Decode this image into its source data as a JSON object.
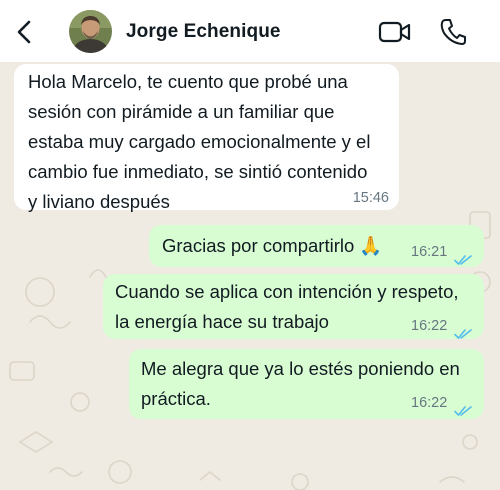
{
  "header": {
    "contact_name": "Jorge Echenique",
    "back_icon": "chevron-left-icon",
    "video_icon": "video-camera-icon",
    "call_icon": "phone-icon"
  },
  "messages": [
    {
      "direction": "incoming",
      "text": "Hola Marcelo, te cuento que probé una\nsesión con pirámide a un familiar que\nestaba muy cargado emocionalmente y el\ncambio fue inmediato, se sintió contenido\ny liviano después",
      "time": "15:46"
    },
    {
      "direction": "outgoing",
      "text": "Gracias por compartirlo 🙏",
      "time": "16:21",
      "status": "read"
    },
    {
      "direction": "outgoing",
      "text": "Cuando se aplica con intención y respeto,\nla energía hace su trabajo",
      "time": "16:22",
      "status": "read"
    },
    {
      "direction": "outgoing",
      "text": "Me alegra que ya lo estés poniendo en\npráctica.",
      "time": "16:22",
      "status": "read"
    }
  ],
  "colors": {
    "header_bg": "#ffffff",
    "chat_bg": "#efeae2",
    "incoming_bubble": "#ffffff",
    "outgoing_bubble": "#d9fdd3",
    "read_ticks": "#53bdeb",
    "timestamp": "#667781"
  }
}
